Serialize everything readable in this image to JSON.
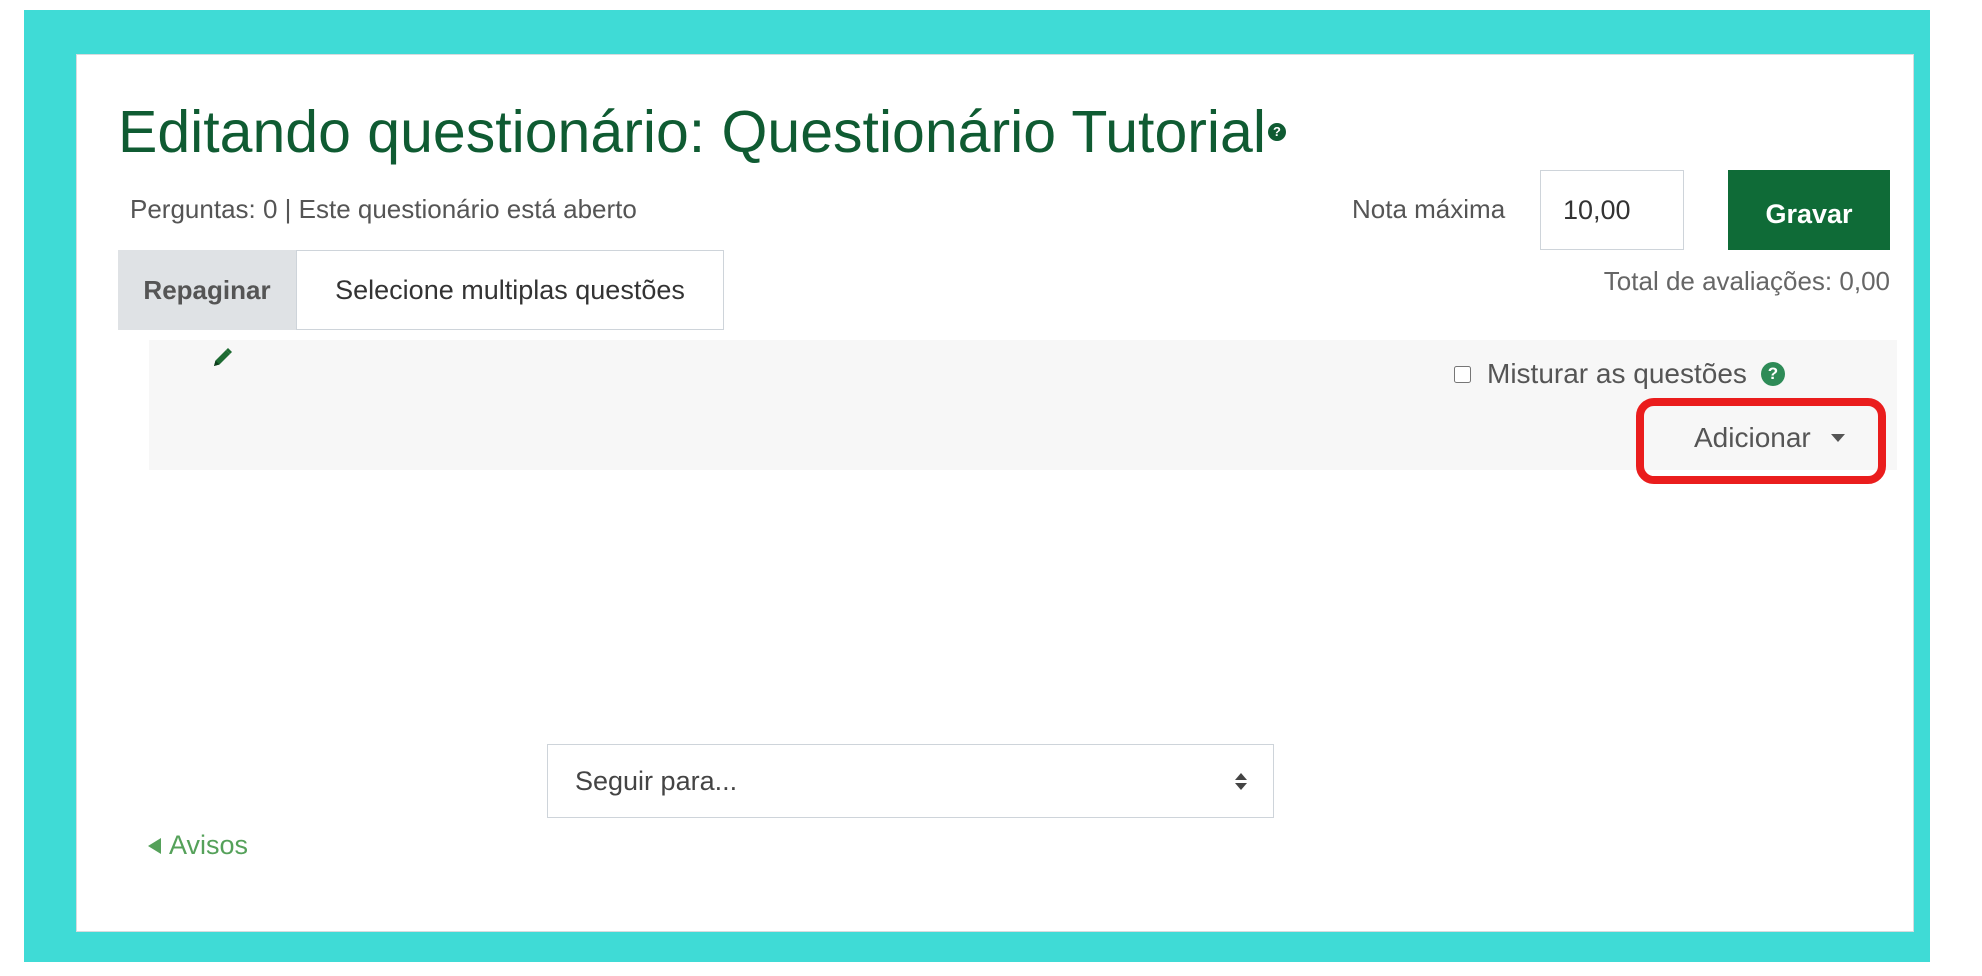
{
  "page": {
    "title": "Editando questionário: Questionário Tutorial",
    "status": "Perguntas: 0 | Este questionário está aberto"
  },
  "grade": {
    "label": "Nota máxima",
    "value": "10,00",
    "save_label": "Gravar",
    "total": "Total de avaliações: 0,00"
  },
  "toolbar": {
    "repaginate_label": "Repaginar",
    "select_multiple_label": "Selecione multiplas questões"
  },
  "section": {
    "shuffle_label": "Misturar as questões",
    "shuffle_checked": false,
    "add_label": "Adicionar"
  },
  "footer": {
    "jump_placeholder": "Seguir para...",
    "back_link": "Avisos"
  },
  "colors": {
    "frame": "#3fdbd6",
    "title": "#0f5b32",
    "save_button": "#0f6b37",
    "highlight": "#ea1d1d",
    "link": "#55a15a"
  },
  "icons": [
    "help-icon",
    "pencil-icon",
    "caret-down-icon",
    "sort-icon",
    "back-arrow-icon"
  ]
}
